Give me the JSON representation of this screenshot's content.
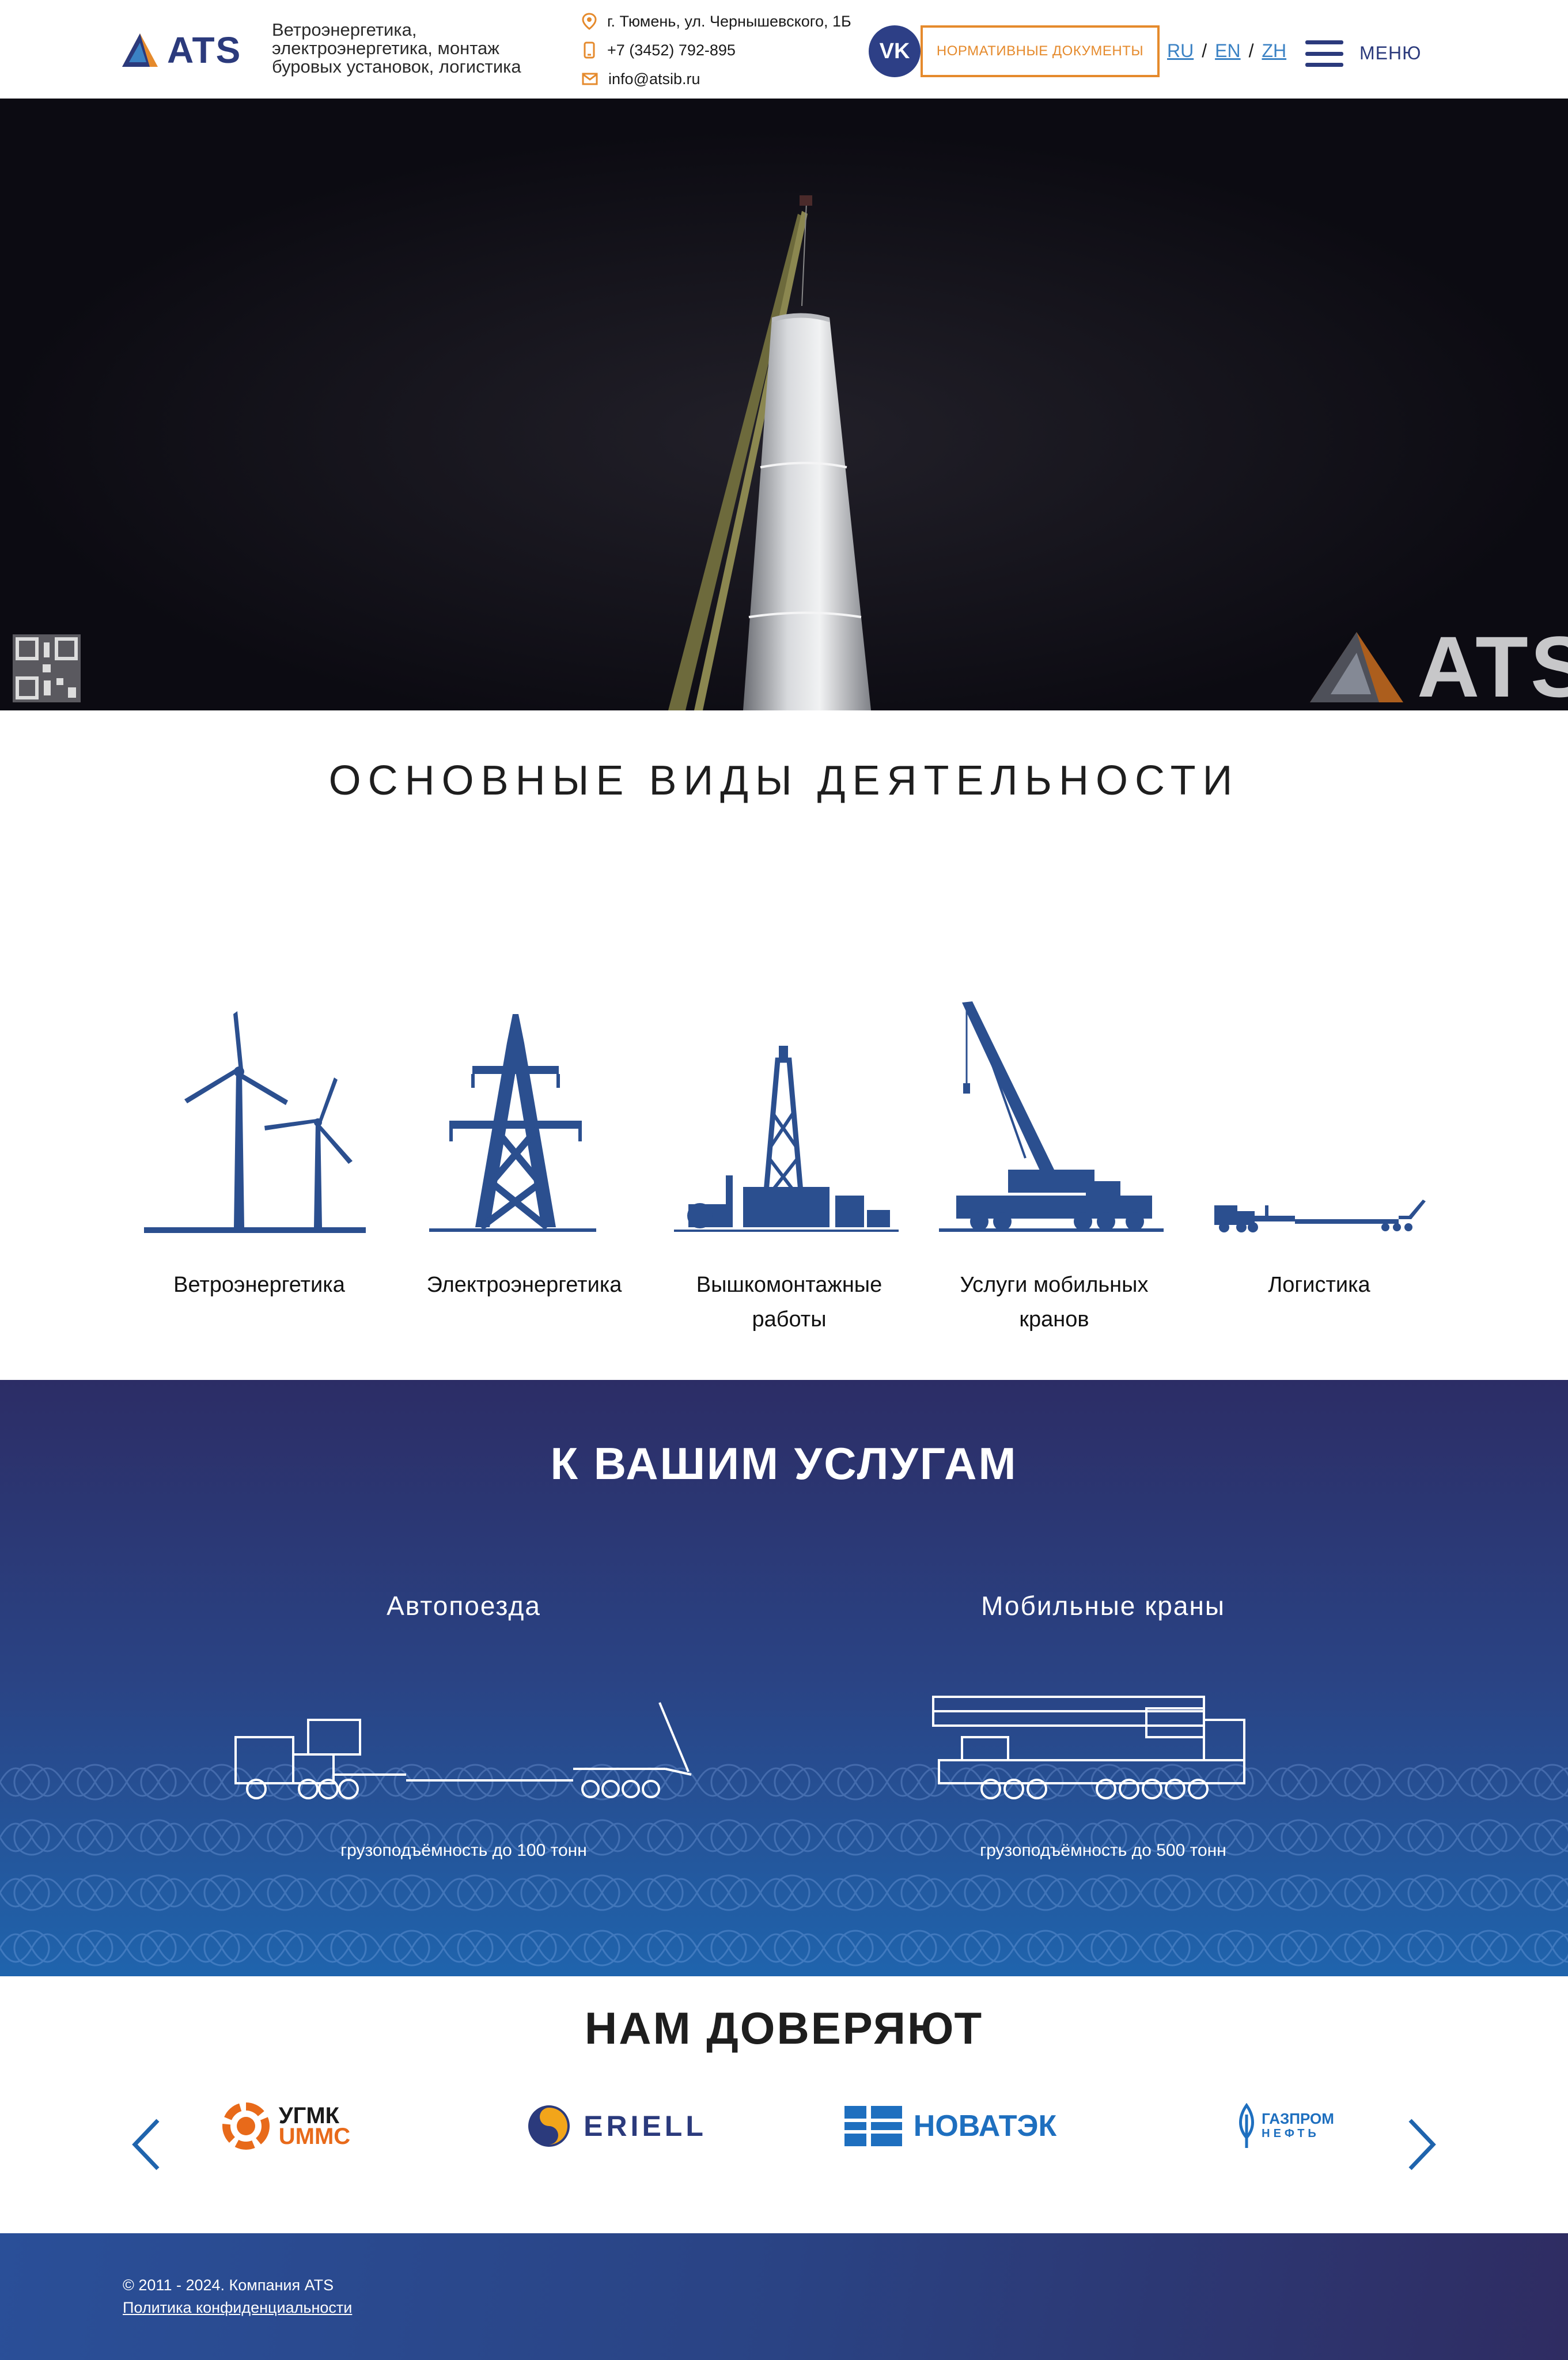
{
  "header": {
    "logo_text": "ATS",
    "tagline": "Ветроэнергетика, электроэнергетика, монтаж буровых установок, логистика",
    "address": "г. Тюмень, ул. Чернышевского, 1Б",
    "phone": "+7 (3452) 792-895",
    "email": "info@atsib.ru",
    "vk_label": "VK",
    "docs_button": "Нормативные документы",
    "languages": [
      "RU",
      "EN",
      "ZH"
    ],
    "lang_separator": "/",
    "menu_label": "МЕНЮ"
  },
  "hero": {
    "watermark": "ATS"
  },
  "activities": {
    "title": "ОСНОВНЫЕ ВИДЫ ДЕЯТЕЛЬНОСТИ",
    "items": [
      {
        "label": "Ветроэнергетика",
        "icon": "wind-turbines-icon"
      },
      {
        "label": "Электроэнергетика",
        "icon": "power-tower-icon"
      },
      {
        "label": "Вышкомонтажные работы",
        "icon": "drilling-rig-icon"
      },
      {
        "label": "Услуги мобильных кранов",
        "icon": "mobile-crane-icon"
      },
      {
        "label": "Логистика",
        "icon": "truck-trailer-icon"
      }
    ]
  },
  "services": {
    "title": "К ВАШИМ УСЛУГАМ",
    "items": [
      {
        "name": "Автопоезда",
        "caption": "грузоподъёмность до 100 тонн"
      },
      {
        "name": "Мобильные краны",
        "caption": "грузоподъёмность до 500 тонн"
      }
    ]
  },
  "clients": {
    "title": "НАМ ДОВЕРЯЮТ",
    "logos": [
      {
        "line1": "УГМК",
        "line2": "UMMC"
      },
      {
        "line1": "ERIELL"
      },
      {
        "line1": "НОВАТЭК"
      },
      {
        "line1": "ГАЗПРОМ",
        "line2": "НЕФТЬ"
      }
    ]
  },
  "footer": {
    "copyright": "© 2011 - 2024. Компания ATS",
    "privacy": "Политика конфиденциальности"
  },
  "colors": {
    "brand_blue": "#2b3a7c",
    "accent_orange": "#e58a2c",
    "link_blue": "#3b82c4",
    "icon_blue": "#2b4f8f"
  }
}
